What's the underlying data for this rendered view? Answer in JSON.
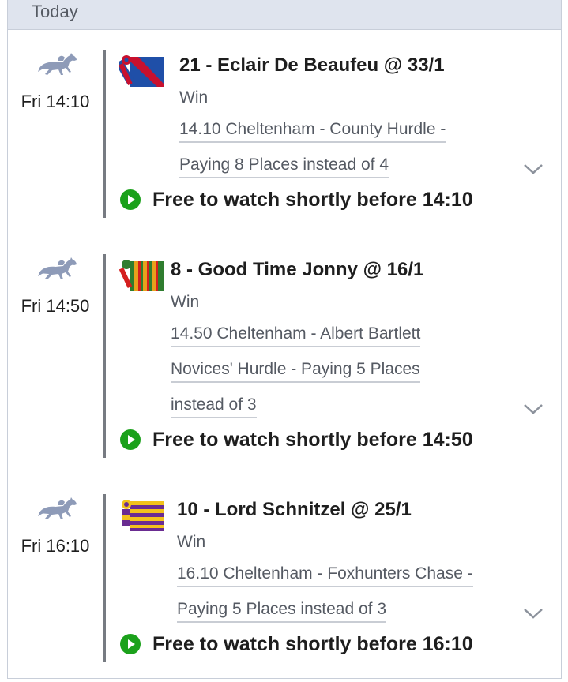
{
  "header": {
    "title": "Today"
  },
  "bets": [
    {
      "day_time": "Fri 14:10",
      "selection": "21 - Eclair De Beaufeu @ 33/1",
      "market": "Win",
      "event_lines": [
        "14.10 Cheltenham - County Hurdle -",
        "Paying 8 Places instead of 4"
      ],
      "watch_text": "Free to watch shortly before 14:10",
      "silks_colors": [
        "#c8102e",
        "#1f4fa8"
      ]
    },
    {
      "day_time": "Fri 14:50",
      "selection": "8 - Good Time Jonny @ 16/1",
      "market": "Win",
      "event_lines": [
        "14.50 Cheltenham - Albert Bartlett",
        "Novices' Hurdle - Paying 5 Places",
        "instead of 3"
      ],
      "watch_text": "Free to watch shortly before 14:50",
      "silks_colors": [
        "#d41f1f",
        "#2f7d2f",
        "#e8a11c"
      ]
    },
    {
      "day_time": "Fri 16:10",
      "selection": "10 - Lord Schnitzel @ 25/1",
      "market": "Win",
      "event_lines": [
        "16.10 Cheltenham - Foxhunters Chase -",
        "Paying 5 Places instead of 3"
      ],
      "watch_text": "Free to watch shortly before 16:10",
      "silks_colors": [
        "#f2c21b",
        "#6a2c91"
      ]
    }
  ],
  "icons": {
    "horse": "horse-racing-icon",
    "play": "play-icon",
    "chevron": "chevron-down-icon"
  },
  "colors": {
    "header_bg": "#dfe4ee",
    "play_green": "#1ba11b",
    "horse_icon": "#8e9bb8",
    "text_dark": "#1e1e1e",
    "text_grey": "#555a63"
  }
}
